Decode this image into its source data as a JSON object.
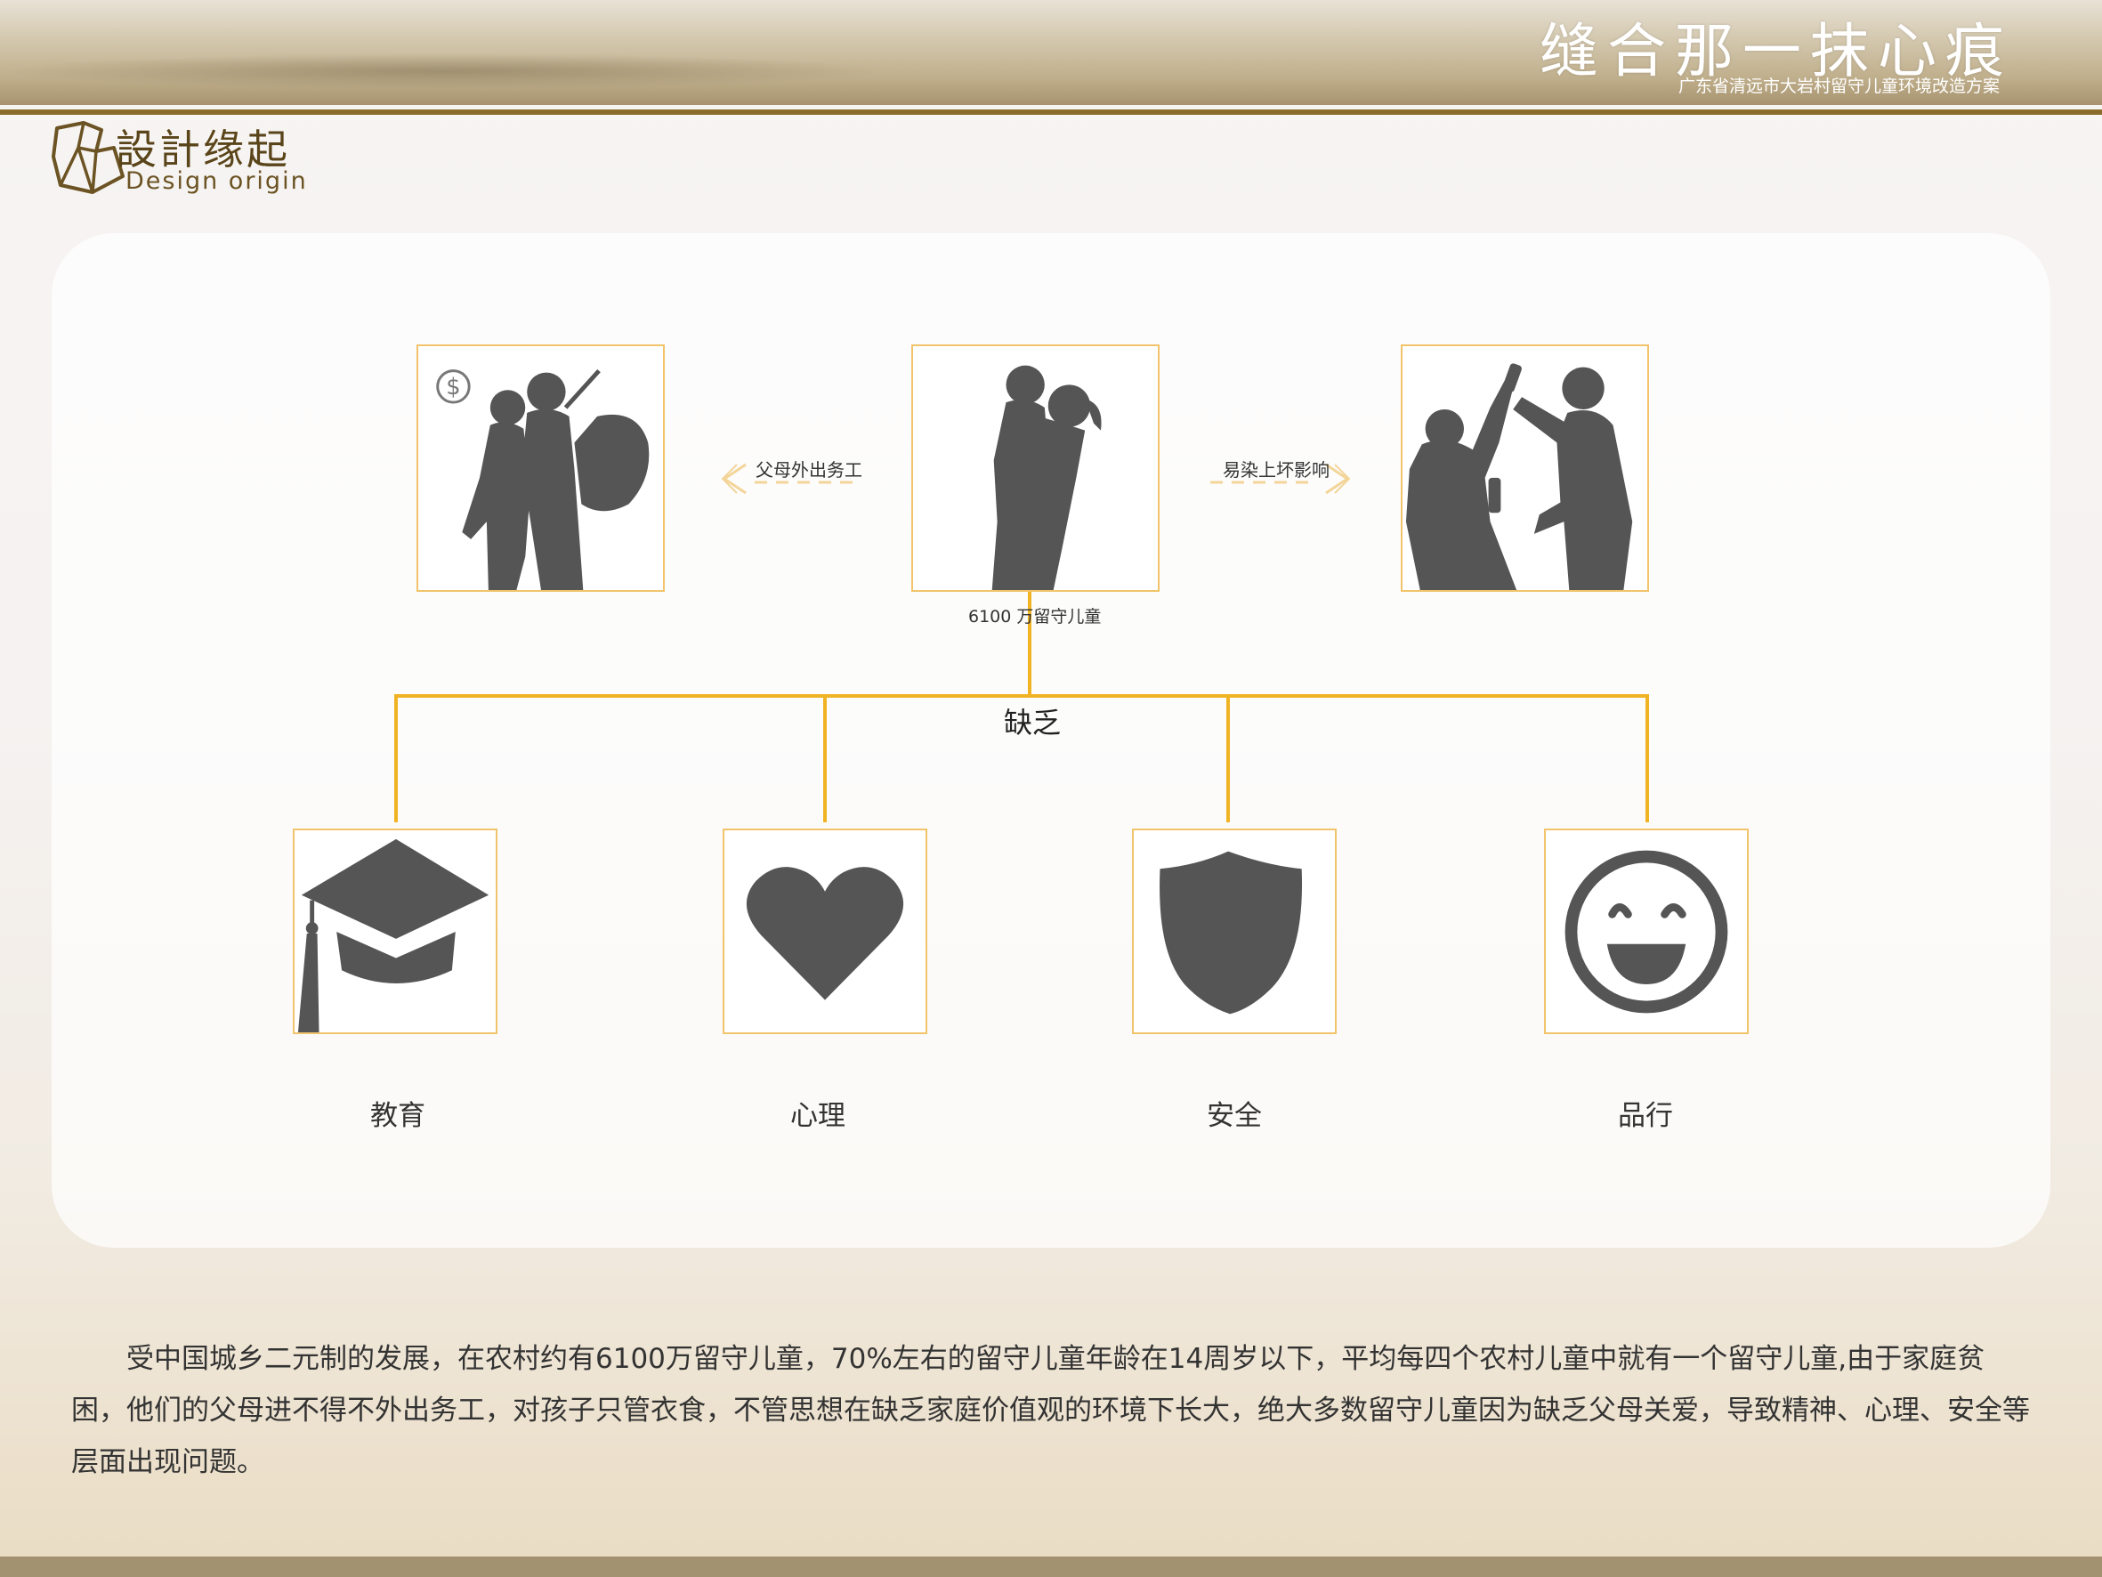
{
  "header": {
    "title": "缝合那一抹心痕",
    "subtitle": "广东省清远市大岩村留守儿童环境改造方案"
  },
  "section": {
    "title_cn": "設計缘起",
    "title_en": "Design origin"
  },
  "diagram": {
    "center_label": "6100 万留守儿童",
    "left_arrow_label": "父母外出务工",
    "right_arrow_label": "易染上坏影响",
    "branch_label": "缺乏",
    "items": [
      {
        "label": "教育",
        "icon": "graduation-cap-icon"
      },
      {
        "label": "心理",
        "icon": "heart-icon"
      },
      {
        "label": "安全",
        "icon": "shield-icon"
      },
      {
        "label": "品行",
        "icon": "smiley-icon"
      }
    ],
    "top_images": [
      "parents-leaving-silhouette",
      "child-silhouette",
      "bad-influence-silhouette"
    ],
    "colors": {
      "accent": "#f0b323",
      "icon": "#555555",
      "brand": "#8b6b2a"
    }
  },
  "description": "受中国城乡二元制的发展，在农村约有6100万留守儿童，70%左右的留守儿童年龄在14周岁以下，平均每四个农村儿童中就有一个留守儿童,由于家庭贫困，他们的父母进不得不外出务工，对孩子只管衣食，不管思想在缺乏家庭价值观的环境下长大，绝大多数留守儿童因为缺乏父母关爱，导致精神、心理、安全等层面出现问题。"
}
